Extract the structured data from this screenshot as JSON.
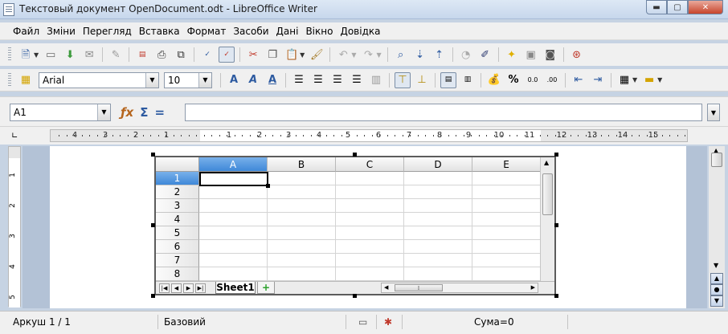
{
  "window": {
    "title": "Текстовый документ OpenDocument.odt - LibreOffice Writer",
    "minimize_glyph": "▬",
    "maximize_glyph": "▢",
    "close_glyph": "✕"
  },
  "menu": [
    {
      "label": "Файл"
    },
    {
      "label": "Зміни"
    },
    {
      "label": "Перегляд"
    },
    {
      "label": "Вставка"
    },
    {
      "label": "Формат"
    },
    {
      "label": "Засоби"
    },
    {
      "label": "Дані"
    },
    {
      "label": "Вікно"
    },
    {
      "label": "Довідка"
    }
  ],
  "formatting": {
    "font_name": "Arial",
    "font_size": "10"
  },
  "formula_bar": {
    "cell_reference": "A1",
    "formula_value": ""
  },
  "ruler": {
    "labels": [
      "4",
      "3",
      "2",
      "1",
      "1",
      "2",
      "3",
      "4",
      "5",
      "6",
      "7",
      "8",
      "9",
      "10",
      "11",
      "12",
      "13",
      "14",
      "15"
    ]
  },
  "vertical_ruler": {
    "labels": [
      "1",
      "2",
      "3",
      "4",
      "5"
    ]
  },
  "spreadsheet": {
    "columns": [
      "A",
      "B",
      "C",
      "D",
      "E"
    ],
    "rows": [
      "1",
      "2",
      "3",
      "4",
      "5",
      "6",
      "7",
      "8"
    ],
    "selected_cell": "A1",
    "sheet_tab": "Sheet1",
    "add_sheet": "+"
  },
  "status": {
    "page": "Аркуш 1 / 1",
    "style": "Базовий",
    "sum": "Сума=0"
  },
  "colors": {
    "selected_header": "#3f88d8",
    "document_background": "#b3c2d6",
    "close_button": "#c7442c"
  }
}
